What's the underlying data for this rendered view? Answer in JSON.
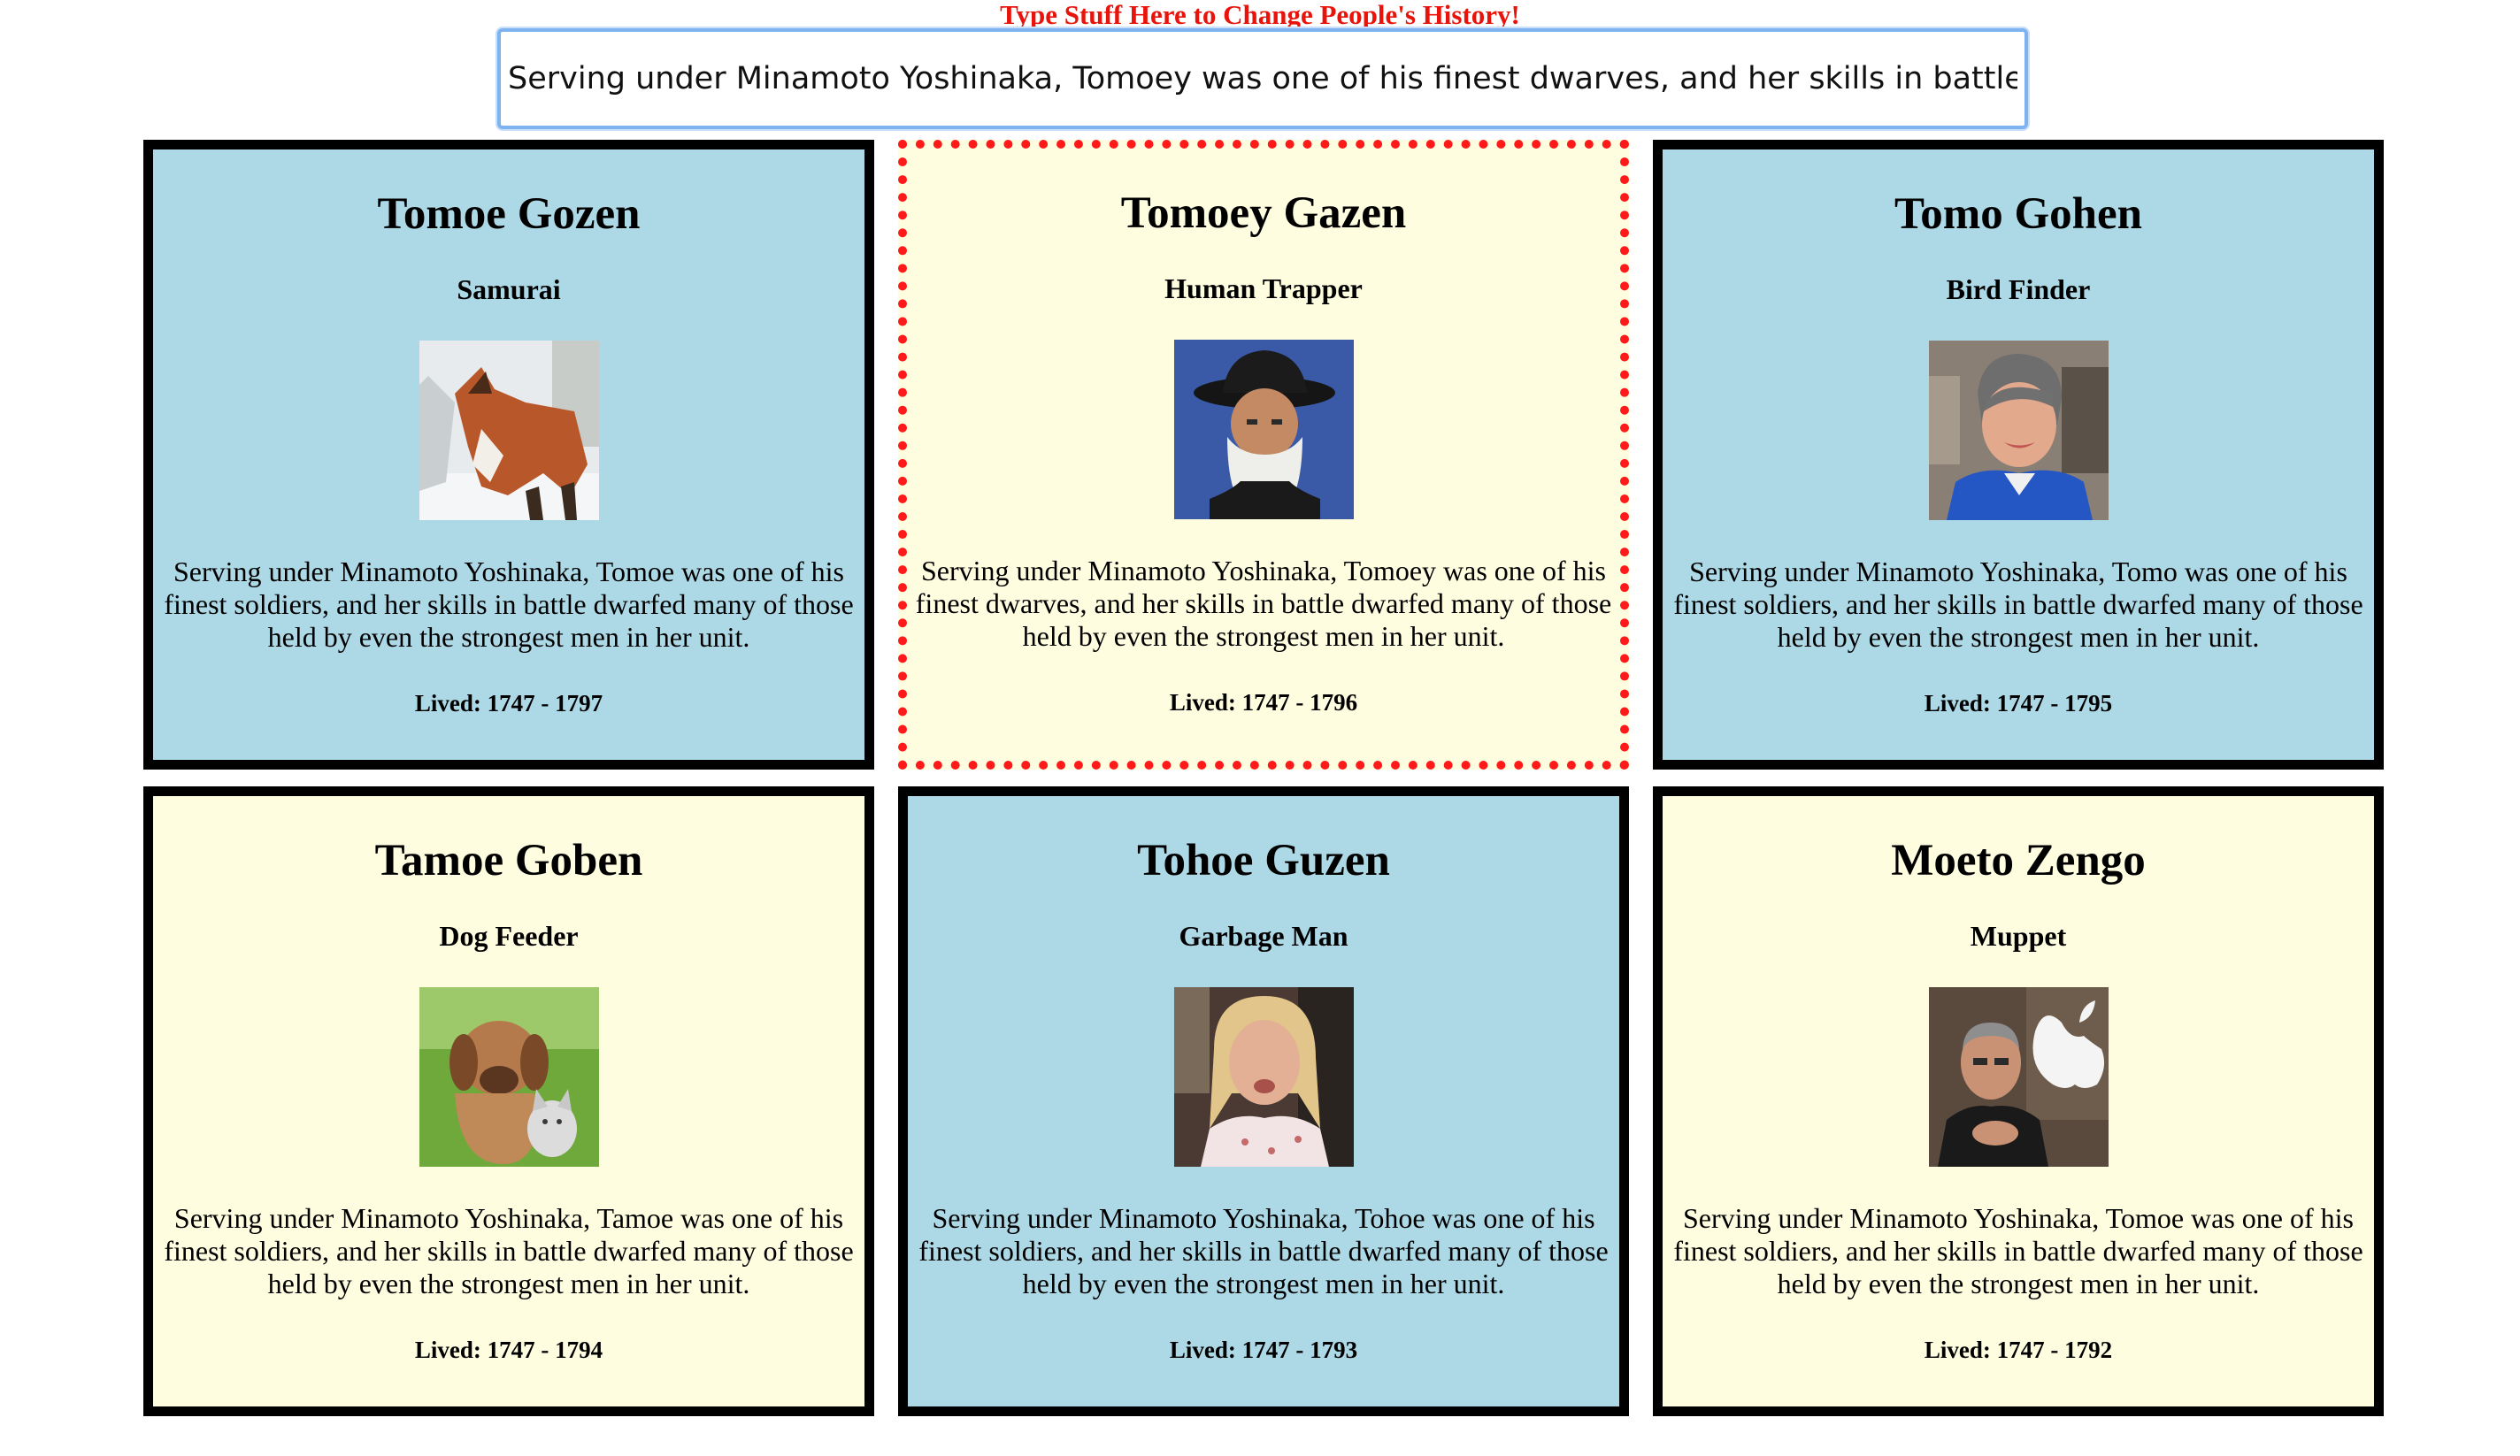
{
  "heading": "Type Stuff Here to Change People's History!",
  "history_input": {
    "value": "Serving under Minamoto Yoshinaka, Tomoey was one of his finest dwarves, and her skills in battle dw"
  },
  "cards": [
    {
      "name": "Tomoe Gozen",
      "job": "Samurai",
      "photo": "fox-photo",
      "bio": "Serving under Minamoto Yoshinaka, Tomoe was one of his finest soldiers, and her skills in battle dwarfed many of those held by even the strongest men in her unit.",
      "lived": "Lived: 1747 - 1797",
      "color": "#add8e6"
    },
    {
      "name": "Tomoey Gazen",
      "job": "Human Trapper",
      "photo": "bearded-man-photo",
      "bio": "Serving under Minamoto Yoshinaka, Tomoey was one of his finest dwarves, and her skills in battle dwarfed many of those held by even the strongest men in her unit.",
      "lived": "Lived: 1747 - 1796",
      "color": "#fffde0"
    },
    {
      "name": "Tomo Gohen",
      "job": "Bird Finder",
      "photo": "woman-portrait-photo",
      "bio": "Serving under Minamoto Yoshinaka, Tomo was one of his finest soldiers, and her skills in battle dwarfed many of those held by even the strongest men in her unit.",
      "lived": "Lived: 1747 - 1795",
      "color": "#add8e6"
    },
    {
      "name": "Tamoe Goben",
      "job": "Dog Feeder",
      "photo": "puppy-kitten-photo",
      "bio": "Serving under Minamoto Yoshinaka, Tamoe was one of his finest soldiers, and her skills in battle dwarfed many of those held by even the strongest men in her unit.",
      "lived": "Lived: 1747 - 1794",
      "color": "#fffde0"
    },
    {
      "name": "Tohoe Guzen",
      "job": "Garbage Man",
      "photo": "blonde-woman-photo",
      "bio": "Serving under Minamoto Yoshinaka, Tohoe was one of his finest soldiers, and her skills in battle dwarfed many of those held by even the strongest men in her unit.",
      "lived": "Lived: 1747 - 1793",
      "color": "#add8e6"
    },
    {
      "name": "Moeto Zengo",
      "job": "Muppet",
      "photo": "man-apple-logo-photo",
      "bio": "Serving under Minamoto Yoshinaka, Tomoe was one of his finest soldiers, and her skills in battle dwarfed many of those held by even the strongest men in her unit.",
      "lived": "Lived: 1747 - 1792",
      "color": "#fffde0"
    }
  ],
  "colors": {
    "heading": "#e8140c",
    "card_blue": "#add8e6",
    "card_yellow": "#fffde0",
    "card_border": "#000000",
    "selected_border": "#ff1a1a",
    "input_focus": "#7eb3ef"
  }
}
